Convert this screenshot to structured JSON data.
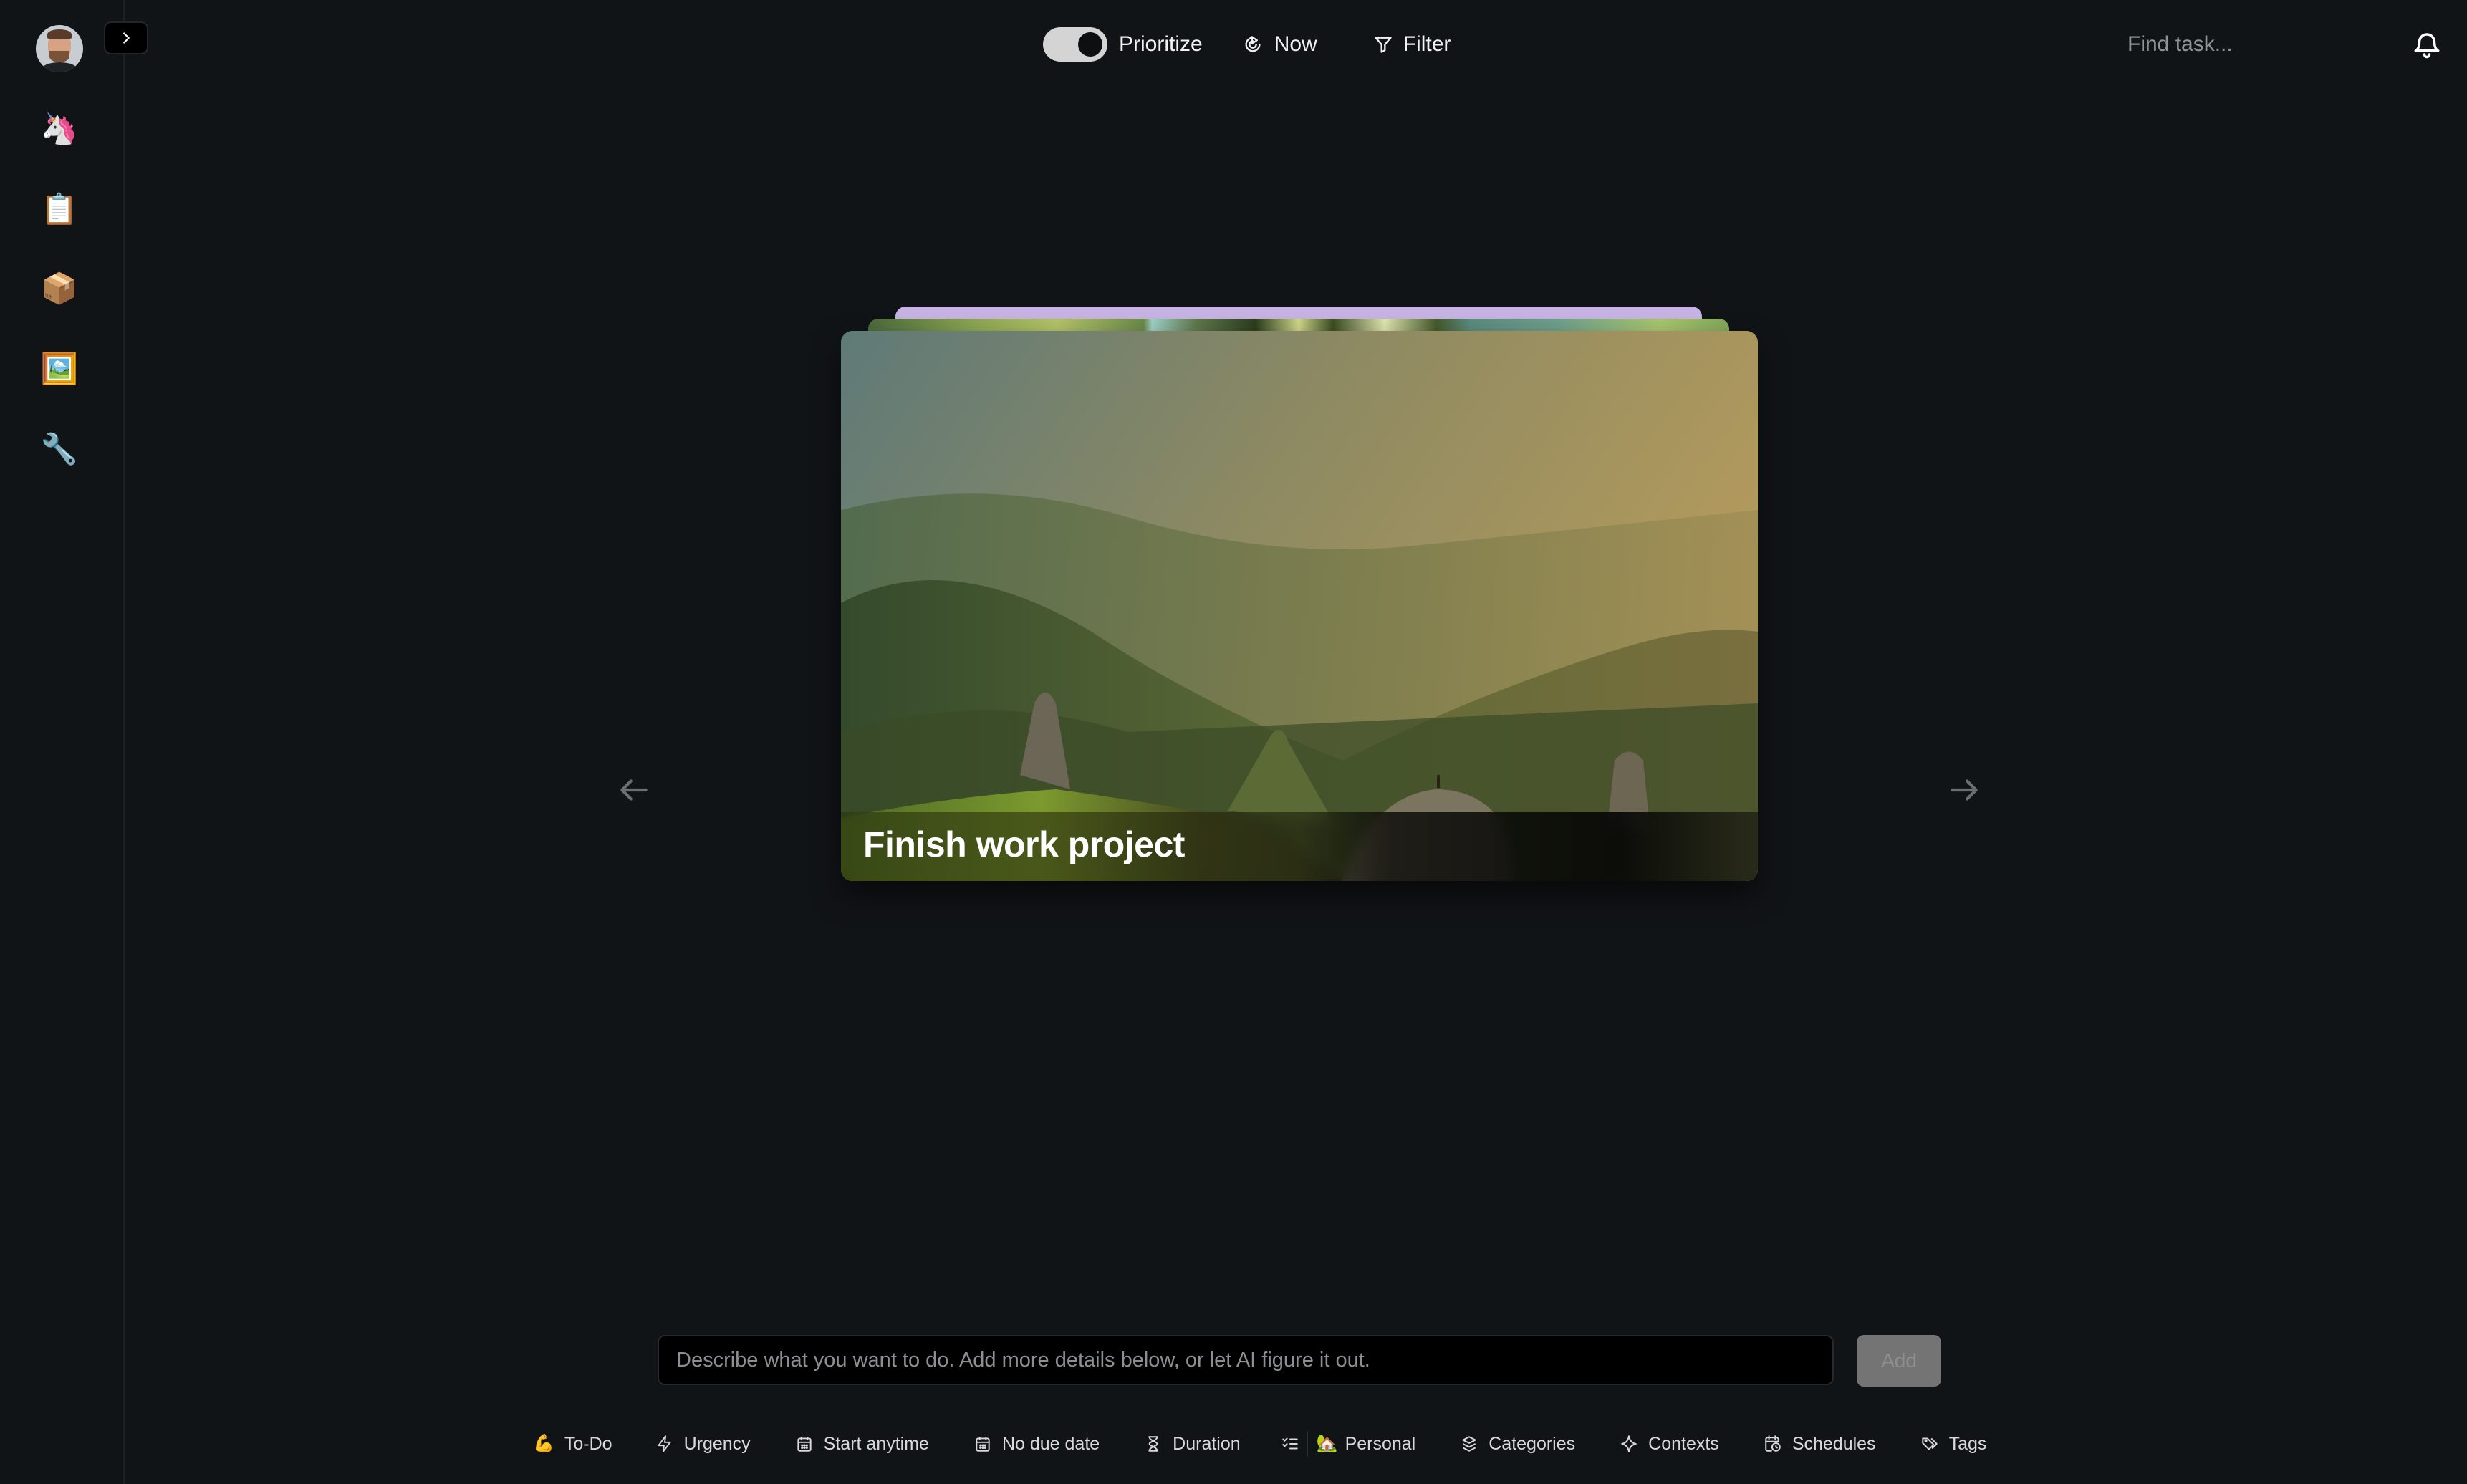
{
  "sidebar": {
    "avatar_alt": "User avatar",
    "collapse_label": "Expand sidebar",
    "items": [
      {
        "name": "unicorn",
        "glyph": "🦄"
      },
      {
        "name": "clipboard",
        "glyph": "📋"
      },
      {
        "name": "package",
        "glyph": "📦"
      },
      {
        "name": "framed-picture",
        "glyph": "🖼️"
      },
      {
        "name": "wrench",
        "glyph": "🔧"
      }
    ]
  },
  "topbar": {
    "prioritize_label": "Prioritize",
    "prioritize_on": true,
    "now_label": "Now",
    "filter_label": "Filter",
    "search_placeholder": "Find task...",
    "search_value": ""
  },
  "card": {
    "title": "Finish work project",
    "stack_colors": [
      "#c7b3e3",
      "#8aa553"
    ]
  },
  "composer": {
    "placeholder": "Describe what you want to do. Add more details below, or let AI figure it out.",
    "value": "",
    "add_label": "Add"
  },
  "toolbar": {
    "todo": {
      "label": "To-Do",
      "glyph": "💪"
    },
    "urgency": {
      "label": "Urgency"
    },
    "start": {
      "label": "Start anytime"
    },
    "due": {
      "label": "No due date"
    },
    "duration": {
      "label": "Duration"
    },
    "personal": {
      "label": "Personal",
      "glyph": "🏡"
    },
    "categories": {
      "label": "Categories"
    },
    "contexts": {
      "label": "Contexts"
    },
    "schedules": {
      "label": "Schedules"
    },
    "tags": {
      "label": "Tags"
    }
  }
}
